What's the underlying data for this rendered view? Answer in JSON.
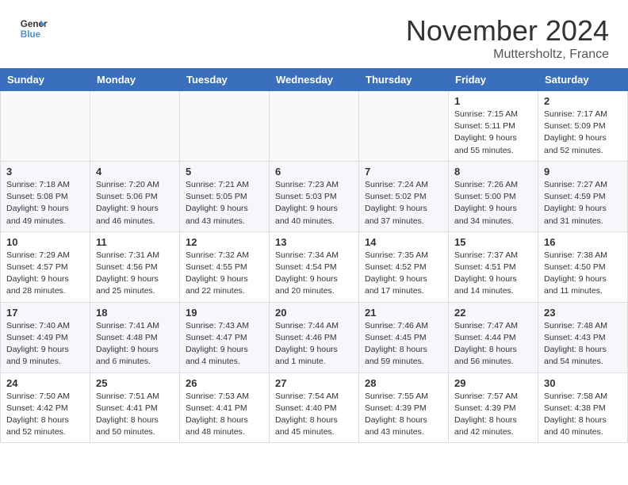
{
  "header": {
    "logo_line1": "General",
    "logo_line2": "Blue",
    "month": "November 2024",
    "location": "Muttersholtz, France"
  },
  "weekdays": [
    "Sunday",
    "Monday",
    "Tuesday",
    "Wednesday",
    "Thursday",
    "Friday",
    "Saturday"
  ],
  "weeks": [
    [
      {
        "day": "",
        "info": ""
      },
      {
        "day": "",
        "info": ""
      },
      {
        "day": "",
        "info": ""
      },
      {
        "day": "",
        "info": ""
      },
      {
        "day": "",
        "info": ""
      },
      {
        "day": "1",
        "info": "Sunrise: 7:15 AM\nSunset: 5:11 PM\nDaylight: 9 hours and 55 minutes."
      },
      {
        "day": "2",
        "info": "Sunrise: 7:17 AM\nSunset: 5:09 PM\nDaylight: 9 hours and 52 minutes."
      }
    ],
    [
      {
        "day": "3",
        "info": "Sunrise: 7:18 AM\nSunset: 5:08 PM\nDaylight: 9 hours and 49 minutes."
      },
      {
        "day": "4",
        "info": "Sunrise: 7:20 AM\nSunset: 5:06 PM\nDaylight: 9 hours and 46 minutes."
      },
      {
        "day": "5",
        "info": "Sunrise: 7:21 AM\nSunset: 5:05 PM\nDaylight: 9 hours and 43 minutes."
      },
      {
        "day": "6",
        "info": "Sunrise: 7:23 AM\nSunset: 5:03 PM\nDaylight: 9 hours and 40 minutes."
      },
      {
        "day": "7",
        "info": "Sunrise: 7:24 AM\nSunset: 5:02 PM\nDaylight: 9 hours and 37 minutes."
      },
      {
        "day": "8",
        "info": "Sunrise: 7:26 AM\nSunset: 5:00 PM\nDaylight: 9 hours and 34 minutes."
      },
      {
        "day": "9",
        "info": "Sunrise: 7:27 AM\nSunset: 4:59 PM\nDaylight: 9 hours and 31 minutes."
      }
    ],
    [
      {
        "day": "10",
        "info": "Sunrise: 7:29 AM\nSunset: 4:57 PM\nDaylight: 9 hours and 28 minutes."
      },
      {
        "day": "11",
        "info": "Sunrise: 7:31 AM\nSunset: 4:56 PM\nDaylight: 9 hours and 25 minutes."
      },
      {
        "day": "12",
        "info": "Sunrise: 7:32 AM\nSunset: 4:55 PM\nDaylight: 9 hours and 22 minutes."
      },
      {
        "day": "13",
        "info": "Sunrise: 7:34 AM\nSunset: 4:54 PM\nDaylight: 9 hours and 20 minutes."
      },
      {
        "day": "14",
        "info": "Sunrise: 7:35 AM\nSunset: 4:52 PM\nDaylight: 9 hours and 17 minutes."
      },
      {
        "day": "15",
        "info": "Sunrise: 7:37 AM\nSunset: 4:51 PM\nDaylight: 9 hours and 14 minutes."
      },
      {
        "day": "16",
        "info": "Sunrise: 7:38 AM\nSunset: 4:50 PM\nDaylight: 9 hours and 11 minutes."
      }
    ],
    [
      {
        "day": "17",
        "info": "Sunrise: 7:40 AM\nSunset: 4:49 PM\nDaylight: 9 hours and 9 minutes."
      },
      {
        "day": "18",
        "info": "Sunrise: 7:41 AM\nSunset: 4:48 PM\nDaylight: 9 hours and 6 minutes."
      },
      {
        "day": "19",
        "info": "Sunrise: 7:43 AM\nSunset: 4:47 PM\nDaylight: 9 hours and 4 minutes."
      },
      {
        "day": "20",
        "info": "Sunrise: 7:44 AM\nSunset: 4:46 PM\nDaylight: 9 hours and 1 minute."
      },
      {
        "day": "21",
        "info": "Sunrise: 7:46 AM\nSunset: 4:45 PM\nDaylight: 8 hours and 59 minutes."
      },
      {
        "day": "22",
        "info": "Sunrise: 7:47 AM\nSunset: 4:44 PM\nDaylight: 8 hours and 56 minutes."
      },
      {
        "day": "23",
        "info": "Sunrise: 7:48 AM\nSunset: 4:43 PM\nDaylight: 8 hours and 54 minutes."
      }
    ],
    [
      {
        "day": "24",
        "info": "Sunrise: 7:50 AM\nSunset: 4:42 PM\nDaylight: 8 hours and 52 minutes."
      },
      {
        "day": "25",
        "info": "Sunrise: 7:51 AM\nSunset: 4:41 PM\nDaylight: 8 hours and 50 minutes."
      },
      {
        "day": "26",
        "info": "Sunrise: 7:53 AM\nSunset: 4:41 PM\nDaylight: 8 hours and 48 minutes."
      },
      {
        "day": "27",
        "info": "Sunrise: 7:54 AM\nSunset: 4:40 PM\nDaylight: 8 hours and 45 minutes."
      },
      {
        "day": "28",
        "info": "Sunrise: 7:55 AM\nSunset: 4:39 PM\nDaylight: 8 hours and 43 minutes."
      },
      {
        "day": "29",
        "info": "Sunrise: 7:57 AM\nSunset: 4:39 PM\nDaylight: 8 hours and 42 minutes."
      },
      {
        "day": "30",
        "info": "Sunrise: 7:58 AM\nSunset: 4:38 PM\nDaylight: 8 hours and 40 minutes."
      }
    ]
  ]
}
